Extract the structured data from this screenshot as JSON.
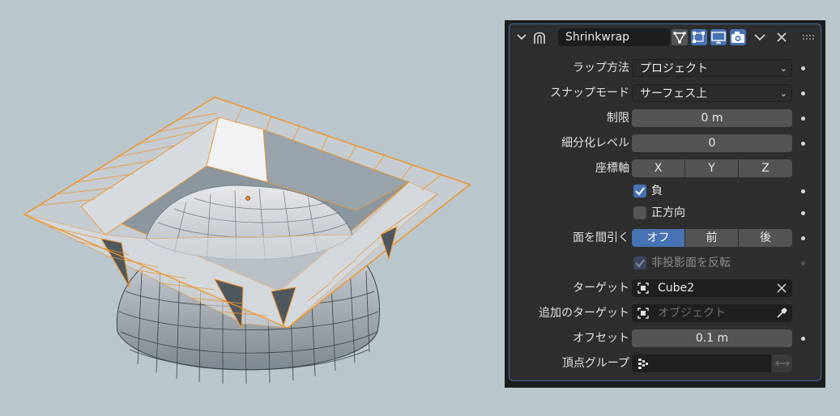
{
  "modifier": {
    "name": "Shrinkwrap",
    "rows": {
      "wrap_method": {
        "label": "ラップ方法",
        "value": "プロジェクト"
      },
      "snap_mode": {
        "label": "スナップモード",
        "value": "サーフェス上"
      },
      "limit": {
        "label": "制限",
        "value": "0 m"
      },
      "subdiv_levels": {
        "label": "細分化レベル",
        "value": "0"
      },
      "axis": {
        "label": "座標軸",
        "options": [
          "X",
          "Y",
          "Z"
        ]
      },
      "negative": {
        "label": "負",
        "checked": true
      },
      "positive": {
        "label": "正方向",
        "checked": false
      },
      "cull_faces": {
        "label": "面を間引く",
        "options": [
          "オフ",
          "前",
          "後"
        ],
        "active": "オフ"
      },
      "invert_cull": {
        "label": "非投影面を反転",
        "checked": true,
        "enabled": false
      },
      "target": {
        "label": "ターゲット",
        "value": "Cube2"
      },
      "aux_target": {
        "label": "追加のターゲット",
        "placeholder": "オブジェクト"
      },
      "offset": {
        "label": "オフセット",
        "value": "0.1 m"
      },
      "vertex_group": {
        "label": "頂点グループ",
        "value": ""
      }
    }
  },
  "colors": {
    "viewport_bg": "#b9c6cc",
    "panel_bg": "#2e2e2e",
    "accent": "#4772b3",
    "selection_outline": "#f0952a"
  },
  "icons": [
    "collapse-chevron-icon",
    "shrinkwrap-modifier-icon",
    "edit-mode-icon",
    "on-cage-icon",
    "realtime-display-icon",
    "render-camera-icon",
    "dropdown-chevron-icon",
    "close-x-icon",
    "drag-grip-icon",
    "object-icon",
    "eyedropper-icon",
    "vertex-group-icon",
    "swap-arrows-icon"
  ]
}
